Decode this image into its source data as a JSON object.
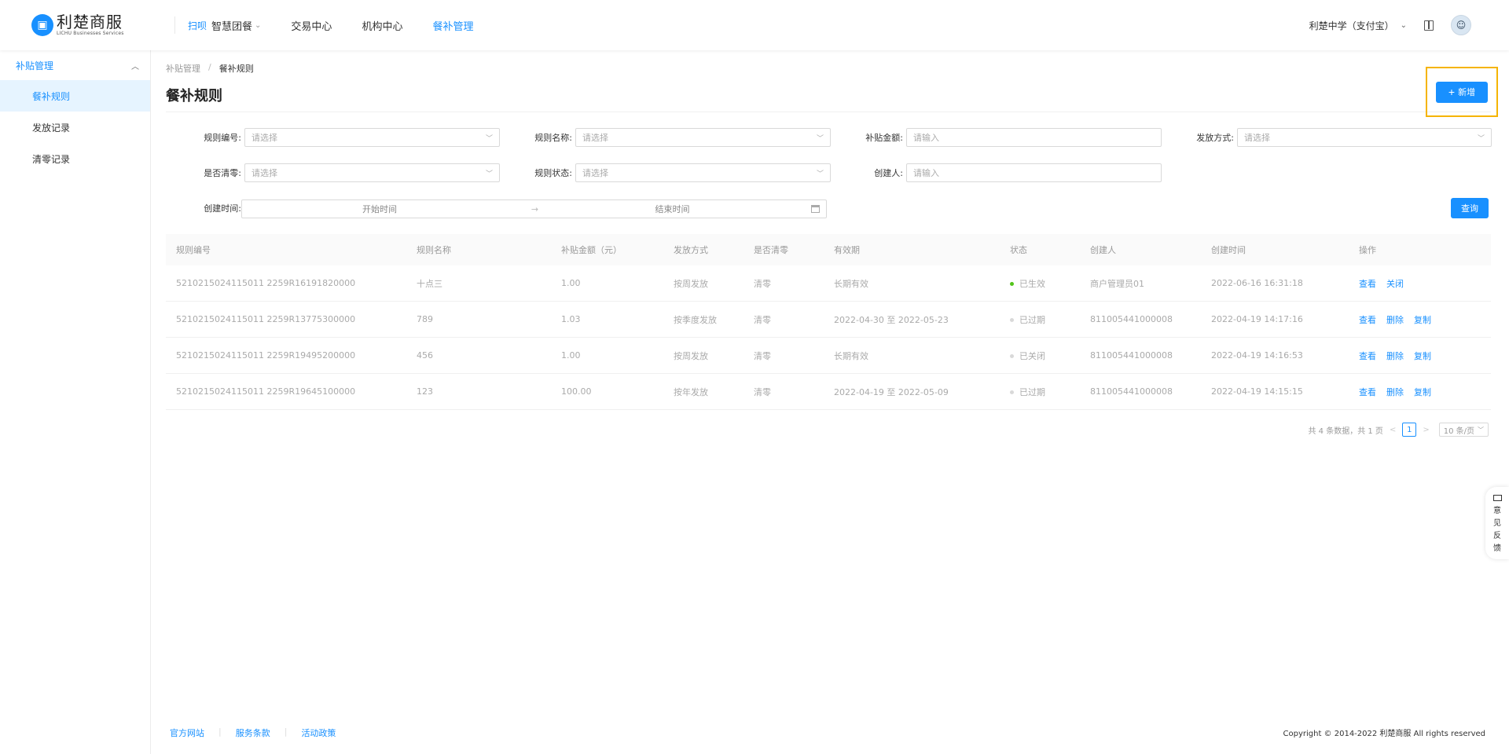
{
  "header": {
    "logo_cn": "利楚商服",
    "logo_en": "LICHU Businesses Services",
    "nav_sub": "扫呗",
    "nav": [
      "智慧团餐",
      "交易中心",
      "机构中心",
      "餐补管理"
    ],
    "org": "利楚中学（支付宝）"
  },
  "sidebar": {
    "group": "补贴管理",
    "items": [
      "餐补规则",
      "发放记录",
      "清零记录"
    ]
  },
  "breadcrumb": {
    "parent": "补贴管理",
    "sep": "/",
    "current": "餐补规则"
  },
  "page_title": "餐补规则",
  "add_button": "新增",
  "filters": {
    "rule_no": {
      "label": "规则编号:",
      "placeholder": "请选择"
    },
    "rule_name": {
      "label": "规则名称:",
      "placeholder": "请选择"
    },
    "amount": {
      "label": "补贴金额:",
      "placeholder": "请输入"
    },
    "method": {
      "label": "发放方式:",
      "placeholder": "请选择"
    },
    "clear": {
      "label": "是否清零:",
      "placeholder": "请选择"
    },
    "status": {
      "label": "规则状态:",
      "placeholder": "请选择"
    },
    "creator": {
      "label": "创建人:",
      "placeholder": "请输入"
    },
    "created": {
      "label": "创建时间:",
      "start": "开始时间",
      "arrow": "→",
      "end": "结束时间"
    }
  },
  "query_button": "查询",
  "table": {
    "headers": [
      "规则编号",
      "规则名称",
      "补贴金额（元）",
      "发放方式",
      "是否清零",
      "有效期",
      "状态",
      "创建人",
      "创建时间",
      "操作"
    ],
    "rows": [
      {
        "id": "5210215024115011 2259R16191820000",
        "name": "十点三",
        "amount": "1.00",
        "method": "按周发放",
        "clear": "清零",
        "period": "长期有效",
        "status": "已生效",
        "status_color": "#52c41a",
        "creator": "商户管理员01",
        "time": "2022-06-16 16:31:18",
        "ops": [
          "查看",
          "关闭"
        ]
      },
      {
        "id": "5210215024115011 2259R13775300000",
        "name": "789",
        "amount": "1.03",
        "method": "按季度发放",
        "clear": "清零",
        "period": "2022-04-30 至 2022-05-23",
        "status": "已过期",
        "status_color": "#d9d9d9",
        "creator": "811005441000008",
        "time": "2022-04-19 14:17:16",
        "ops": [
          "查看",
          "删除",
          "复制"
        ]
      },
      {
        "id": "5210215024115011 2259R19495200000",
        "name": "456",
        "amount": "1.00",
        "method": "按周发放",
        "clear": "清零",
        "period": "长期有效",
        "status": "已关闭",
        "status_color": "#d9d9d9",
        "creator": "811005441000008",
        "time": "2022-04-19 14:16:53",
        "ops": [
          "查看",
          "删除",
          "复制"
        ]
      },
      {
        "id": "5210215024115011 2259R19645100000",
        "name": "123",
        "amount": "100.00",
        "method": "按年发放",
        "clear": "清零",
        "period": "2022-04-19 至 2022-05-09",
        "status": "已过期",
        "status_color": "#d9d9d9",
        "creator": "811005441000008",
        "time": "2022-04-19 14:15:15",
        "ops": [
          "查看",
          "删除",
          "复制"
        ]
      }
    ]
  },
  "pagination": {
    "summary": "共 4 条数据，共 1 页",
    "prev": "<",
    "page": "1",
    "next": ">",
    "size": "10 条/页"
  },
  "footer": {
    "links": [
      "官方网站",
      "服务条款",
      "活动政策"
    ],
    "copyright": "Copyright © 2014-2022 利楚商服 All rights reserved"
  },
  "feedback": [
    "意",
    "见",
    "反",
    "馈"
  ]
}
